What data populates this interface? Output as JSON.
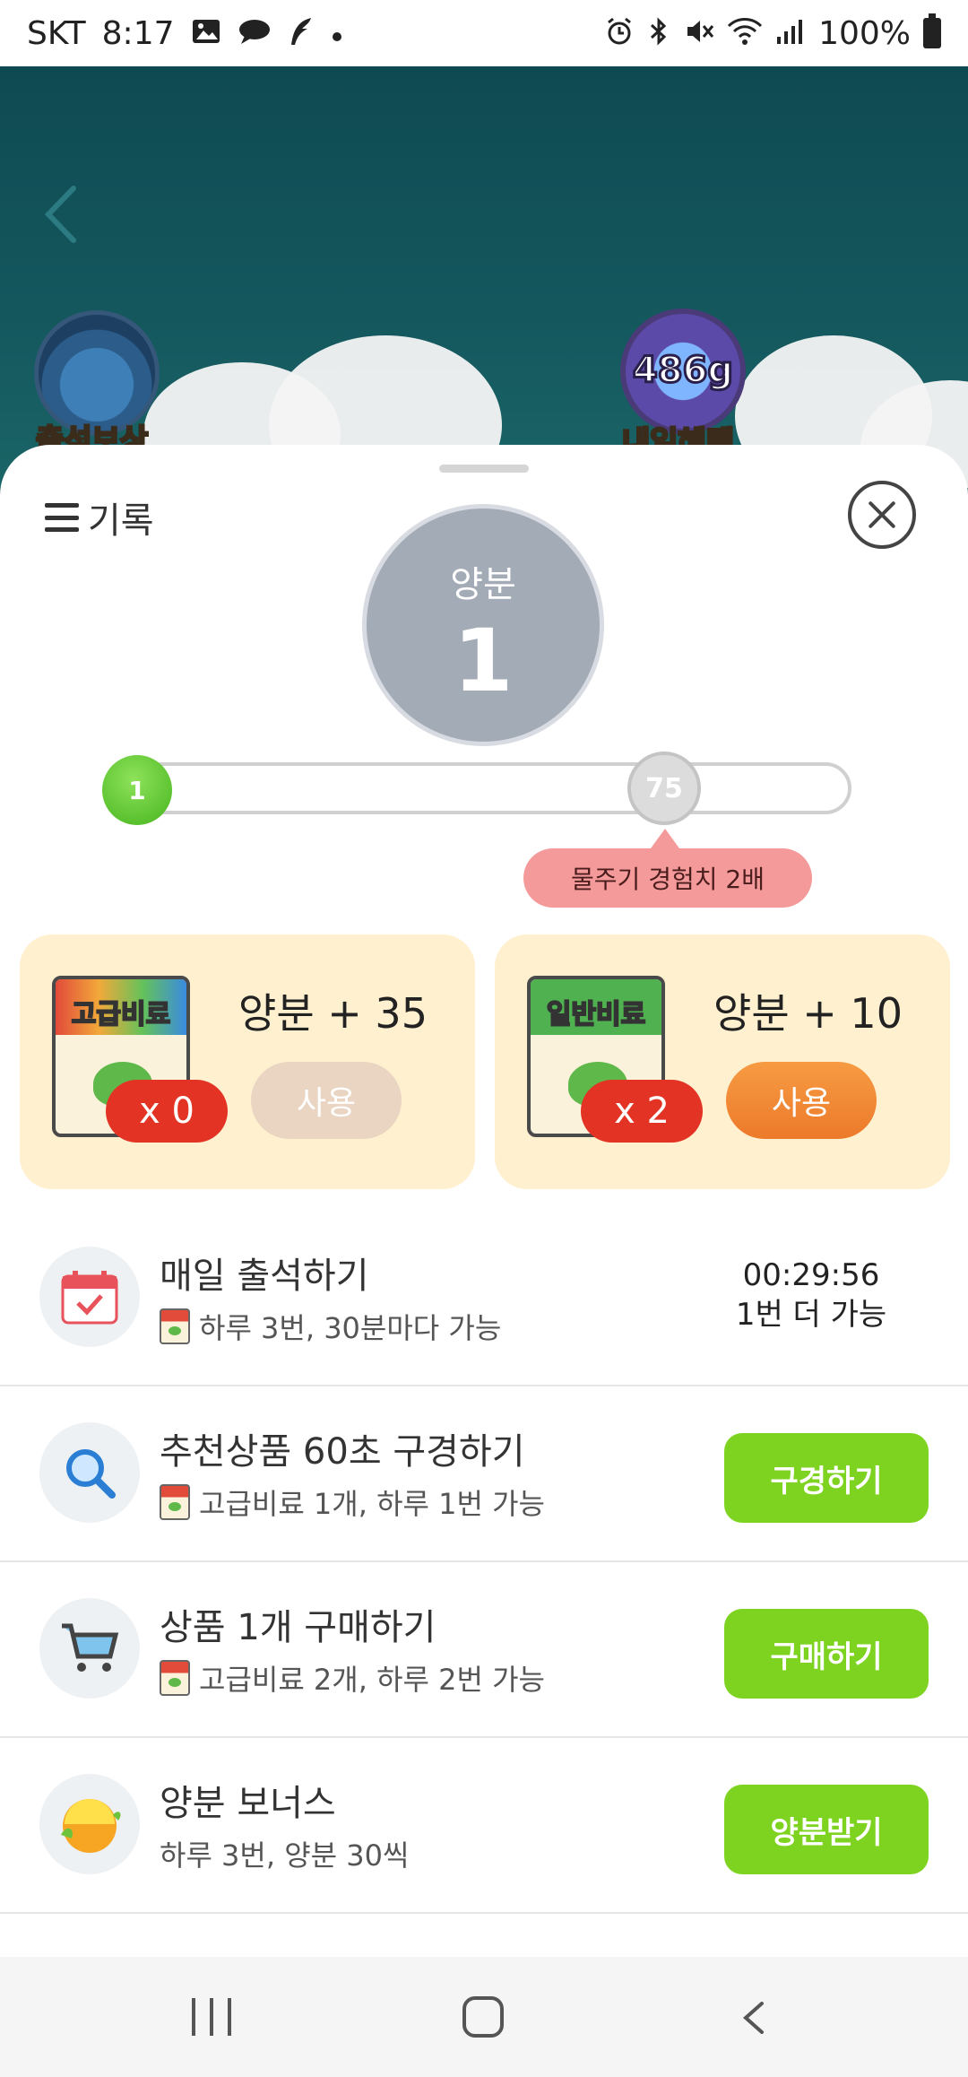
{
  "status_bar": {
    "carrier": "SKT",
    "time": "8:17",
    "battery": "100%",
    "left_icons": [
      "gallery-icon",
      "chat-bubble-icon",
      "feather-icon",
      "dot-icon"
    ],
    "right_icons": [
      "alarm-icon",
      "bluetooth-icon",
      "mute-icon",
      "wifi-icon",
      "signal-icon",
      "battery-icon"
    ]
  },
  "game": {
    "left_badge_label": "출석보상",
    "right_badge_value": "486g",
    "right_badge_label": "내일혜택"
  },
  "sheet": {
    "history_label": "기록",
    "level": {
      "label": "양분",
      "value": "1"
    },
    "progress": {
      "start_level": "1",
      "target_level": "75",
      "fraction": 0.0
    },
    "tooltip": "물주기 경험치 2배"
  },
  "fertilizers": [
    {
      "bag_label": "고급비료",
      "title": "양분 + 35",
      "count": "x 0",
      "button": "사용",
      "enabled": false
    },
    {
      "bag_label": "일반비료",
      "title": "양분 + 10",
      "count": "x 2",
      "button": "사용",
      "enabled": true
    }
  ],
  "tasks": [
    {
      "title": "매일 출석하기",
      "subtitle": "하루 3번, 30분마다 가능",
      "icon": "calendar-icon",
      "timer": "00:29:56",
      "timer_note": "1번 더 가능"
    },
    {
      "title": "추천상품 60초 구경하기",
      "subtitle": "고급비료 1개, 하루 1번 가능",
      "icon": "search-icon",
      "button": "구경하기"
    },
    {
      "title": "상품 1개 구매하기",
      "subtitle": "고급비료 2개, 하루 2번 가능",
      "icon": "cart-icon",
      "button": "구매하기"
    },
    {
      "title": "양분 보너스",
      "subtitle": "하루 3번, 양분 30씩",
      "icon": "nutrient-orb-icon",
      "button": "양분받기"
    }
  ],
  "colors": {
    "accent_green": "#7ed321",
    "use_orange": "#ec7a2a",
    "badge_red": "#e23324",
    "tooltip_pink": "#f59a9a",
    "card_cream": "#fff0cf"
  }
}
